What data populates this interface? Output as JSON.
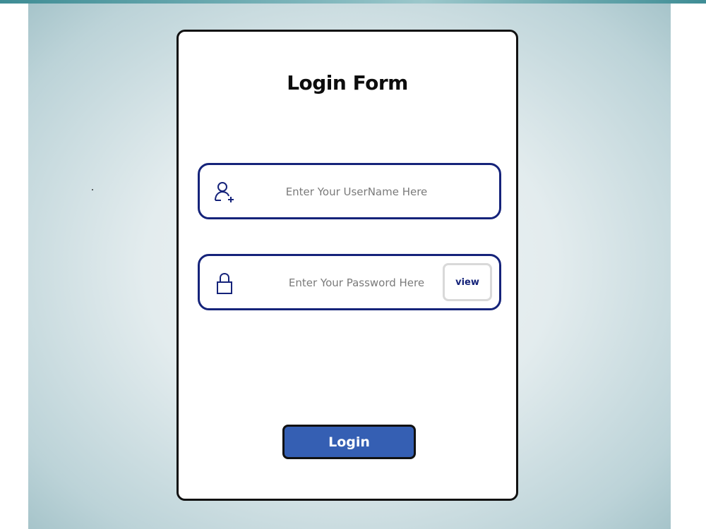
{
  "form": {
    "title": "Login Form",
    "username": {
      "icon": "user-add-icon",
      "placeholder": "Enter Your UserName Here",
      "value": ""
    },
    "password": {
      "icon": "lock-icon",
      "placeholder": "Enter Your Password Here",
      "value": "",
      "view_label": "view"
    },
    "login_label": "Login"
  },
  "colors": {
    "field_border": "#15237a",
    "login_button": "#355fb3",
    "card_border": "#111111"
  }
}
